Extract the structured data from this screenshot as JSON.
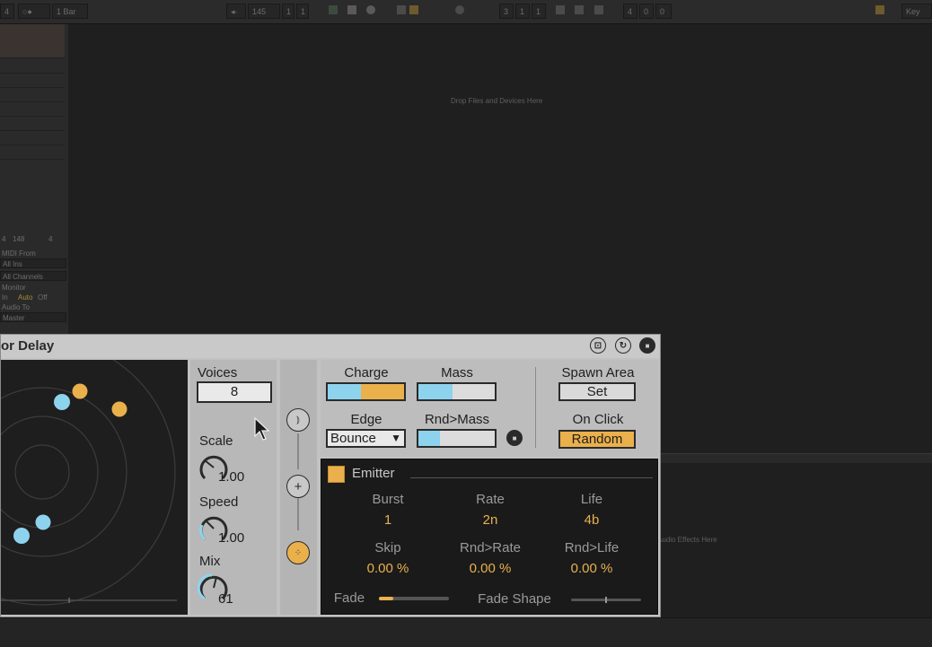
{
  "transport": {
    "midi_label": "4",
    "launch_quant": "1 Bar",
    "tempo": "145",
    "time_sig_num": "1",
    "time_sig_den": "1",
    "position": [
      "3",
      "1",
      "1"
    ],
    "loop_length": [
      "4",
      "0",
      "0"
    ],
    "key_label": "Key"
  },
  "track": {
    "io_numbers": [
      "4",
      "148",
      "4"
    ],
    "midi_from_label": "MIDI From",
    "midi_from_value": "All Ins",
    "channel_value": "All Channels",
    "monitor_label": "Monitor",
    "monitor_options": [
      "In",
      "Auto",
      "Off"
    ],
    "audio_to_label": "Audio To",
    "audio_to_value": "Master"
  },
  "drop_hint": "Drop Files and Devices Here",
  "drop_hint_audio": "Audio Effects Here",
  "device": {
    "title": "or Delay",
    "title_icons": [
      "hotswap-icon",
      "refresh-icon",
      "save-icon"
    ],
    "voices_label": "Voices",
    "voices_value": "8",
    "scale_label": "Scale",
    "scale_value": "1.00",
    "speed_label": "Speed",
    "speed_value": "1.00",
    "mix_label": "Mix",
    "mix_value": "61",
    "charge_label": "Charge",
    "mass_label": "Mass",
    "edge_label": "Edge",
    "edge_value": "Bounce",
    "rnd_mass_label": "Rnd>Mass",
    "spawn_area_label": "Spawn Area",
    "spawn_set_label": "Set",
    "on_click_label": "On Click",
    "on_click_value": "Random",
    "colors": {
      "blue": "#8ed3ee",
      "orange": "#eab04c",
      "accent_value": "#e8b04f"
    },
    "emitter": {
      "title": "Emitter",
      "params": [
        {
          "label": "Burst",
          "value": "1"
        },
        {
          "label": "Rate",
          "value": "2n"
        },
        {
          "label": "Life",
          "value": "4b"
        },
        {
          "label": "Skip",
          "value": "0.00 %"
        },
        {
          "label": "Rnd>Rate",
          "value": "0.00 %"
        },
        {
          "label": "Rnd>Life",
          "value": "0.00 %"
        }
      ],
      "fade_label": "Fade",
      "fade_shape_label": "Fade Shape"
    }
  }
}
